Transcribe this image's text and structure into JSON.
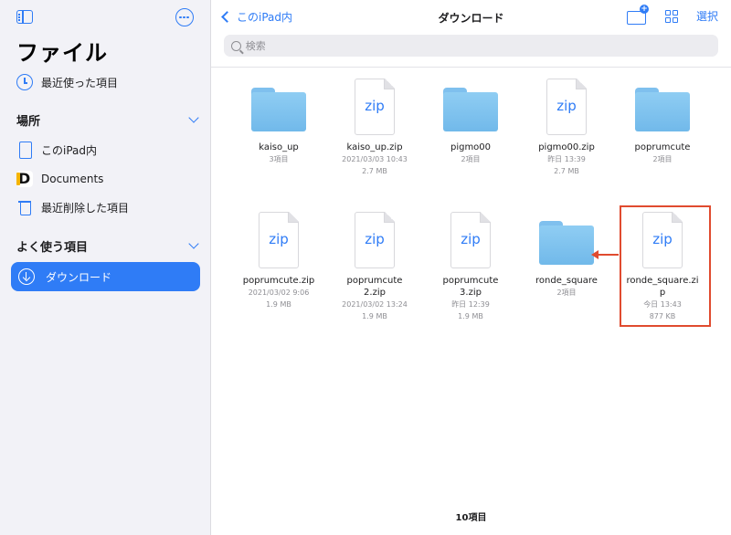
{
  "sidebar": {
    "title": "ファイル",
    "recents_label": "最近使った項目",
    "locations": {
      "header": "場所",
      "items": [
        {
          "label": "このiPad内",
          "icon": "ipad-icon"
        },
        {
          "label": "Documents",
          "icon": "documents-app-icon"
        },
        {
          "label": "最近削除した項目",
          "icon": "trash-icon"
        }
      ]
    },
    "favorites": {
      "header": "よく使う項目",
      "items": [
        {
          "label": "ダウンロード",
          "icon": "download-icon",
          "selected": true
        }
      ]
    }
  },
  "nav": {
    "back_label": "このiPad内",
    "title": "ダウンロード",
    "select_label": "選択"
  },
  "search": {
    "placeholder": "検索"
  },
  "items": [
    {
      "type": "folder",
      "name": "kaiso_up",
      "meta1": "3項目",
      "meta2": ""
    },
    {
      "type": "zip",
      "name": "kaiso_up.zip",
      "meta1": "2021/03/03 10:43",
      "meta2": "2.7 MB"
    },
    {
      "type": "folder",
      "name": "pigmo00",
      "meta1": "2項目",
      "meta2": ""
    },
    {
      "type": "zip",
      "name": "pigmo00.zip",
      "meta1": "昨日 13:39",
      "meta2": "2.7 MB"
    },
    {
      "type": "folder",
      "name": "poprumcute",
      "meta1": "2項目",
      "meta2": ""
    },
    {
      "type": "zip",
      "name": "poprumcute.zip",
      "meta1": "2021/03/02 9:06",
      "meta2": "1.9 MB"
    },
    {
      "type": "zip",
      "name": "poprumcute\n2.zip",
      "meta1": "2021/03/02 13:24",
      "meta2": "1.9 MB"
    },
    {
      "type": "zip",
      "name": "poprumcute\n3.zip",
      "meta1": "昨日 12:39",
      "meta2": "1.9 MB"
    },
    {
      "type": "folder",
      "name": "ronde_square",
      "meta1": "2項目",
      "meta2": ""
    },
    {
      "type": "zip",
      "name": "ronde_square.zi\np",
      "meta1": "今日 13:43",
      "meta2": "877 KB"
    }
  ],
  "zip_label": "zip",
  "footer": {
    "count": "10項目"
  },
  "colors": {
    "accent": "#2f7cf6",
    "annotation": "#e04b2f",
    "folder": "#7fc0ee"
  }
}
